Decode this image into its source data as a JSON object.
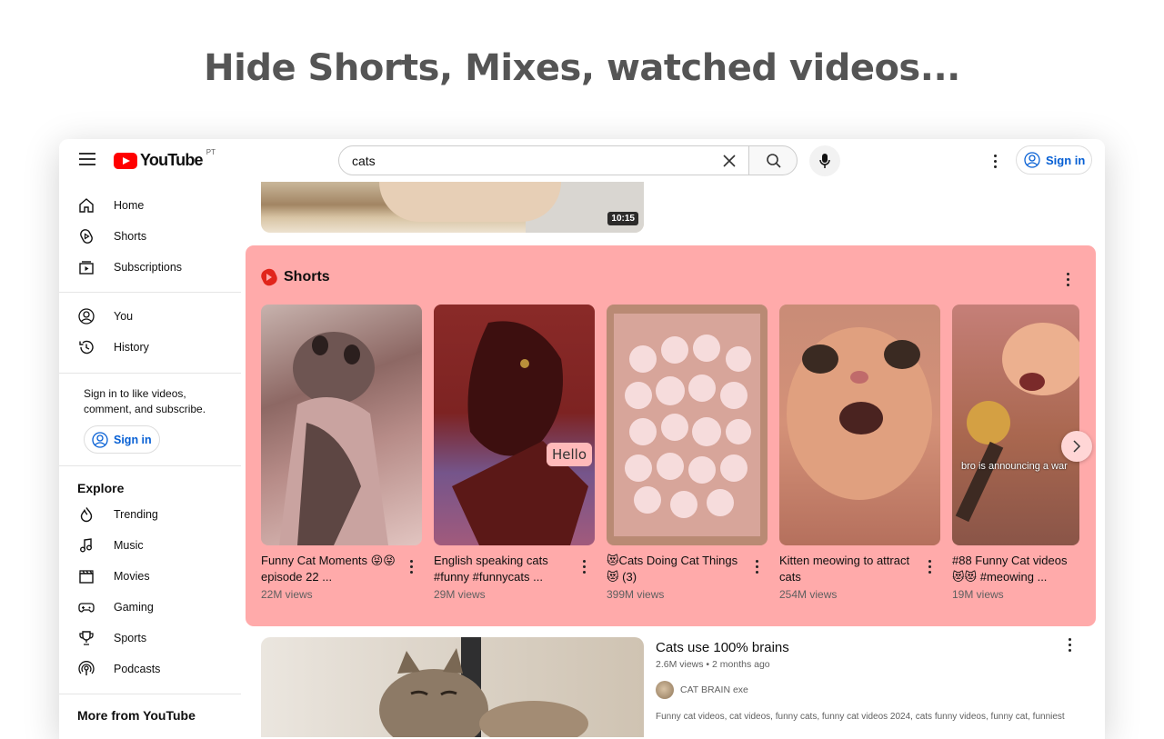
{
  "headline": "Hide Shorts, Mixes, watched videos...",
  "colors": {
    "brand_red": "#ff0000",
    "shorts_highlight": "#ffaaaa",
    "link_blue": "#065fd4"
  },
  "header": {
    "logo_text": "YouTube",
    "region": "PT",
    "search": {
      "value": "cats"
    },
    "sign_in_label": "Sign in",
    "icons": [
      "menu-icon",
      "youtube-logo-icon",
      "clear-icon",
      "search-icon",
      "mic-icon",
      "more-vert-icon",
      "account-icon"
    ]
  },
  "sidebar": {
    "main": [
      {
        "label": "Home",
        "icon": "home-icon"
      },
      {
        "label": "Shorts",
        "icon": "shorts-icon"
      },
      {
        "label": "Subscriptions",
        "icon": "subscriptions-icon"
      }
    ],
    "you": [
      {
        "label": "You",
        "icon": "you-icon"
      },
      {
        "label": "History",
        "icon": "history-icon"
      }
    ],
    "signin_hint": "Sign in to like videos, comment, and subscribe.",
    "signin_label": "Sign in",
    "explore_title": "Explore",
    "explore": [
      {
        "label": "Trending",
        "icon": "trending-icon"
      },
      {
        "label": "Music",
        "icon": "music-icon"
      },
      {
        "label": "Movies",
        "icon": "movies-icon"
      },
      {
        "label": "Gaming",
        "icon": "gaming-icon"
      },
      {
        "label": "Sports",
        "icon": "sports-icon"
      },
      {
        "label": "Podcasts",
        "icon": "podcasts-icon"
      }
    ],
    "more_title": "More from YouTube"
  },
  "top_video": {
    "duration": "10:15"
  },
  "shorts": {
    "title": "Shorts",
    "items": [
      {
        "title": "Funny Cat Moments 😝😝 episode 22 ...",
        "views": "22M views"
      },
      {
        "title": "English speaking cats #funny #funnycats ...",
        "views": "29M views",
        "overlay": "Hello"
      },
      {
        "title": "😻Cats Doing Cat Things😻 (3)",
        "views": "399M views"
      },
      {
        "title": "Kitten meowing to attract cats",
        "views": "254M views"
      },
      {
        "title": "#88 Funny Cat videos 😻😻 #meowing ...",
        "views": "19M views",
        "overlay": "bro is announcing a war"
      }
    ]
  },
  "result_video": {
    "title": "Cats use 100% brains",
    "views": "2.6M views",
    "age": "2 months ago",
    "meta": "2.6M views • 2 months ago",
    "channel": "CAT BRAIN exe",
    "description": "Funny cat videos, cat videos, funny cats, funny cat videos 2024, cats funny videos, funny cat, funniest"
  }
}
